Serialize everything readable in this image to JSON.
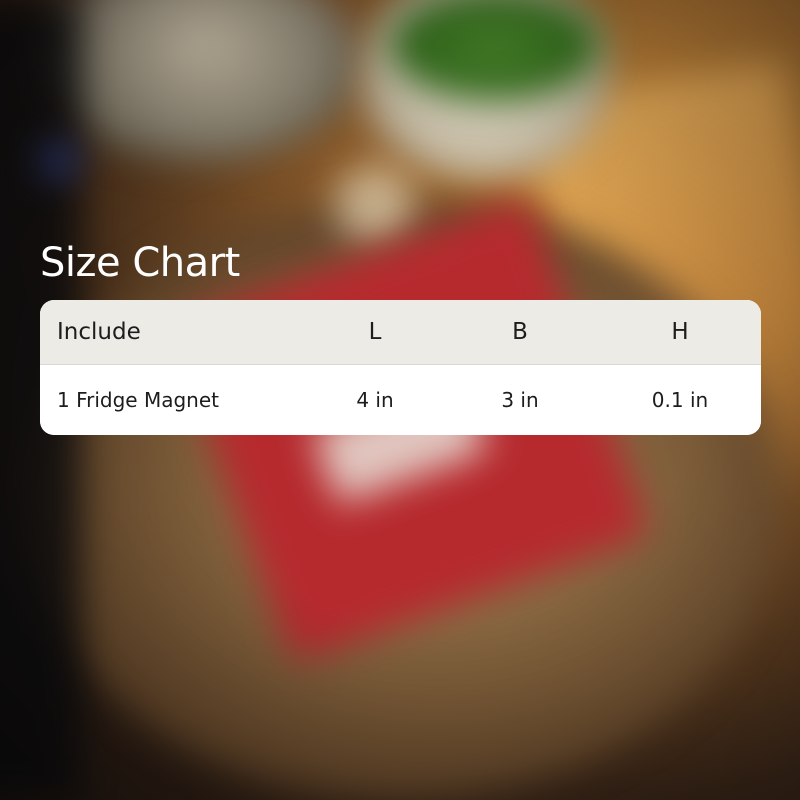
{
  "title": "Size Chart",
  "table": {
    "headers": [
      "Include",
      "L",
      "B",
      "H"
    ],
    "rows": [
      [
        "1 Fridge Magnet",
        "4 in",
        "3 in",
        "0.1 in"
      ]
    ]
  }
}
